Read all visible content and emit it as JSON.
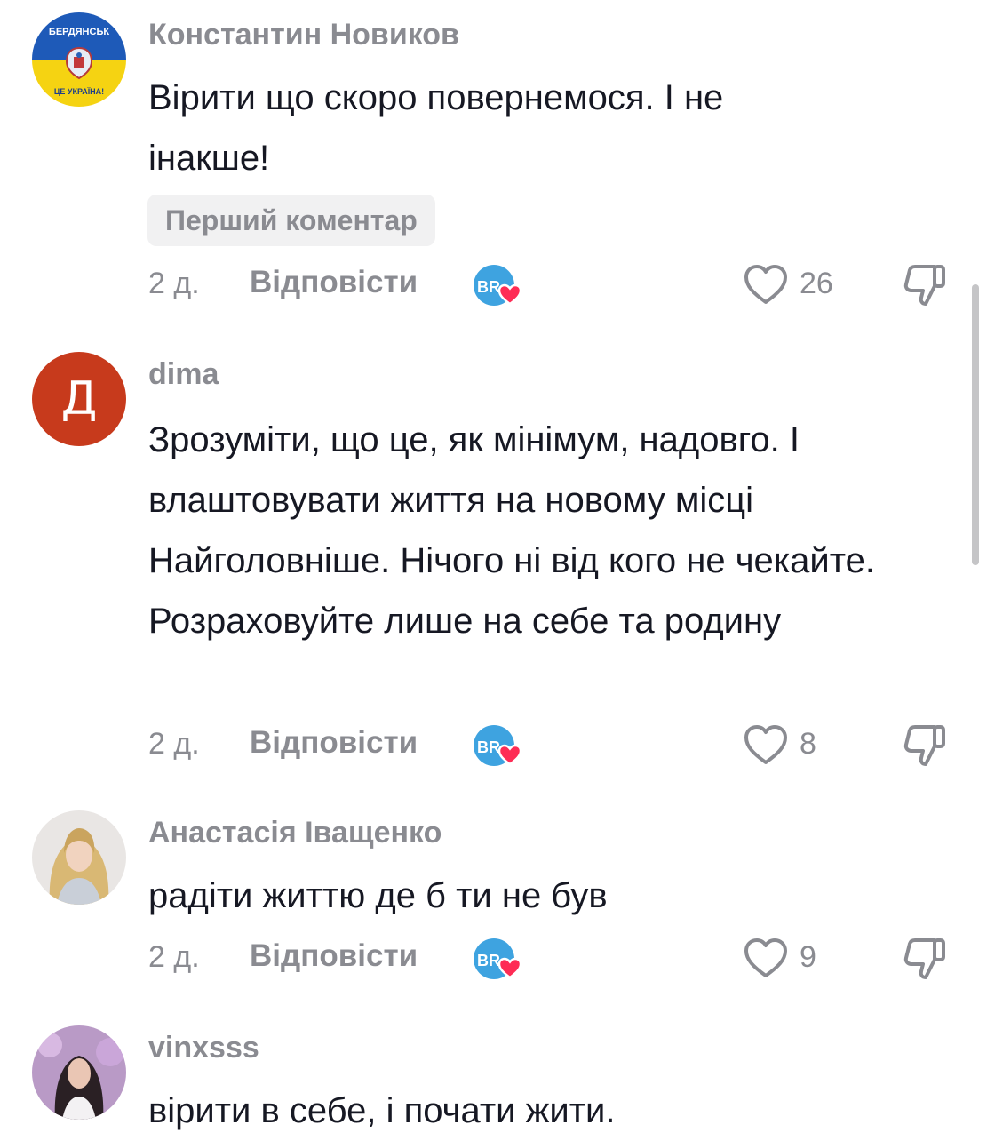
{
  "comments": [
    {
      "username": "Константин Новиков",
      "avatar": {
        "kind": "flag-emblem",
        "top_text": "БЕРДЯНСЬК",
        "bottom_text": "ЦЕ УКРАЇНА!",
        "colors": [
          "#1e5ab8",
          "#f5d312"
        ]
      },
      "text": "Вірити що скоро повернемося. І не інакше!",
      "badge": "Перший коментар",
      "time": "2 д.",
      "reply_label": "Відповісти",
      "likes": "26"
    },
    {
      "username": "dima",
      "avatar": {
        "kind": "letter",
        "letter": "Д",
        "color": "#c73a1c"
      },
      "text": "Зрозуміти, що це, як мінімум, надовго. І влаштовувати життя на новому місці Найголовніше. Нічого ні від кого не чекайте. Розраховуйте лише на себе та родину",
      "time": "2 д.",
      "reply_label": "Відповісти",
      "likes": "8"
    },
    {
      "username": "Анастасія Іващенко",
      "avatar": {
        "kind": "photo"
      },
      "text": "радіти життю де б ти не був",
      "time": "2 д.",
      "reply_label": "Відповісти",
      "likes": "9"
    },
    {
      "username": "vinxsss",
      "avatar": {
        "kind": "photo"
      },
      "text": "вірити в себе, і почати жити."
    }
  ],
  "icons": {
    "creator_reaction": "creator-liked-icon",
    "creator_initials": "BR",
    "like": "heart-outline-icon",
    "dislike": "thumbs-down-outline-icon"
  },
  "colors": {
    "text": "#161823",
    "secondary": "#8a8b91",
    "badge_bg": "#f1f1f2",
    "heart_accent": "#fe2c55",
    "creator_avatar": "#3ea3e0"
  }
}
